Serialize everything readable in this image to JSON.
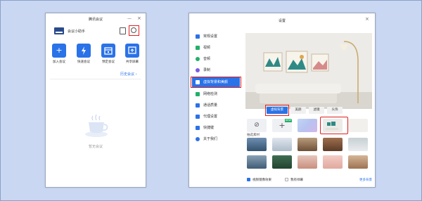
{
  "meeting_window": {
    "title": "腾讯会议",
    "user_name": "会议小助手",
    "actions": [
      {
        "label": "加入会议",
        "icon": "plus-icon"
      },
      {
        "label": "快速会议",
        "icon": "lightning-icon"
      },
      {
        "label": "预定会议",
        "icon": "calendar-icon"
      },
      {
        "label": "共享屏幕",
        "icon": "share-screen-icon"
      }
    ],
    "history_link": "历史会议 ›",
    "empty_text": "暂无会议",
    "minimize_glyph": "—",
    "close_glyph": "×"
  },
  "settings_window": {
    "title": "设置",
    "close_glyph": "×",
    "sidebar": [
      {
        "label": "常规设置",
        "color": "#2a72e8"
      },
      {
        "label": "视频",
        "color": "#22b06a"
      },
      {
        "label": "音频",
        "color": "#22b06a"
      },
      {
        "label": "录制",
        "color": "#7b5be0"
      },
      {
        "label": "虚拟背景和美颜",
        "color": "#2a72e8",
        "active": true
      },
      {
        "label": "网络检测",
        "color": "#22b06a"
      },
      {
        "label": "通话质量",
        "color": "#2a72e8"
      },
      {
        "label": "代理设置",
        "color": "#2a72e8"
      },
      {
        "label": "快捷键",
        "color": "#2a72e8"
      },
      {
        "label": "关于我们",
        "color": "#2a72e8"
      }
    ],
    "tabs": [
      "虚拟背景",
      "美颜",
      "滤镜",
      "头饰"
    ],
    "none_glyph": "⊘",
    "add_glyph": "+",
    "new_badge": "NEW",
    "section_label": "抽选素材",
    "option_mirror": "视频镜像效果",
    "option_green": "我有绿幕",
    "more_link": "更多背景",
    "accent_color": "#2a72e8",
    "highlight_color": "#e02020"
  }
}
